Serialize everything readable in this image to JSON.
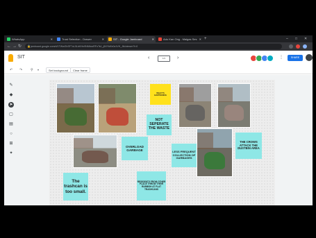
{
  "browser": {
    "tabs": [
      {
        "label": "WhatsApp",
        "active": false,
        "favicon_color": "#25d366"
      },
      {
        "label": "Trust Selection - Drawer",
        "active": false,
        "favicon_color": "#4285f4"
      },
      {
        "label": "SIT - Google Jamboard",
        "active": true,
        "favicon_color": "#f9ab00"
      },
      {
        "label": "Adu Kan Ong - Maigas Ses",
        "active": false,
        "favicon_color": "#ea4335"
      }
    ],
    "url": "jamboard.google.com/d/1TWwGhSF7oL5LbKHn9NMbxxRFoTs1_j6XYkKb0z1VH_Jtk/viewer?f=0"
  },
  "header": {
    "app_title": "SIT",
    "frame_indicator": "1/1",
    "share_label": "SHARE",
    "collaborators": [
      "#e8453c",
      "#34a853",
      "#4285f4",
      "#00acc1"
    ]
  },
  "toolbar": {
    "set_background_label": "Set background",
    "clear_frame_label": "Clear frame"
  },
  "side_tools": [
    "pen-icon",
    "eraser-icon",
    "select-icon",
    "sticky-note-icon",
    "image-icon",
    "circle-icon",
    "text-box-icon",
    "laser-icon"
  ],
  "notes": [
    {
      "id": "whats-happening",
      "text": "WHAT'S HAPPENING",
      "color": "#ffe11c"
    },
    {
      "id": "not-separate",
      "text": "NOT SEPERATE THE WASTE",
      "color": "#8ee7e6"
    },
    {
      "id": "overload-garbage",
      "text": "OVERLOAD GARBAGE",
      "color": "#8ee7e6"
    },
    {
      "id": "less-frequent",
      "text": "LESS FREQUENT COLLECTION OF GARBAGES",
      "color": "#8ee7e6"
    },
    {
      "id": "crows-attack",
      "text": "THE CROWS ATTACK THE DUSTBIN AREA",
      "color": "#8ee7e6"
    },
    {
      "id": "trashcan-small",
      "text": "The trashcan is too small.",
      "color": "#8ee7e6"
    },
    {
      "id": "residents-throw",
      "text": "RESIDENTS FROM OTHER PLACE THROW THEIR RUBBISH AT FLAT TRASHCANS",
      "color": "#8ee7e6"
    }
  ],
  "photos": [
    {
      "id": "photo-trash-pile-1",
      "sky": "#b8c6d1",
      "ground": "#7a6a4a",
      "accent": "#3b6b2e"
    },
    {
      "id": "photo-trash-pile-2",
      "sky": "#7f8b6c",
      "ground": "#b9a27a",
      "accent": "#c0392b"
    },
    {
      "id": "photo-bins-courtyard",
      "sky": "#cfd8dc",
      "ground": "#8d8d83",
      "accent": "#6d4c41"
    },
    {
      "id": "photo-dumpster-wall",
      "sky": "#9e9e9e",
      "ground": "#8c8476",
      "accent": "#5d5d5d"
    },
    {
      "id": "photo-bins-street",
      "sky": "#b0bec5",
      "ground": "#7b7b72",
      "accent": "#a1887f"
    },
    {
      "id": "photo-green-bins",
      "sky": "#90a4ae",
      "ground": "#6d6a61",
      "accent": "#2e7d32"
    }
  ]
}
